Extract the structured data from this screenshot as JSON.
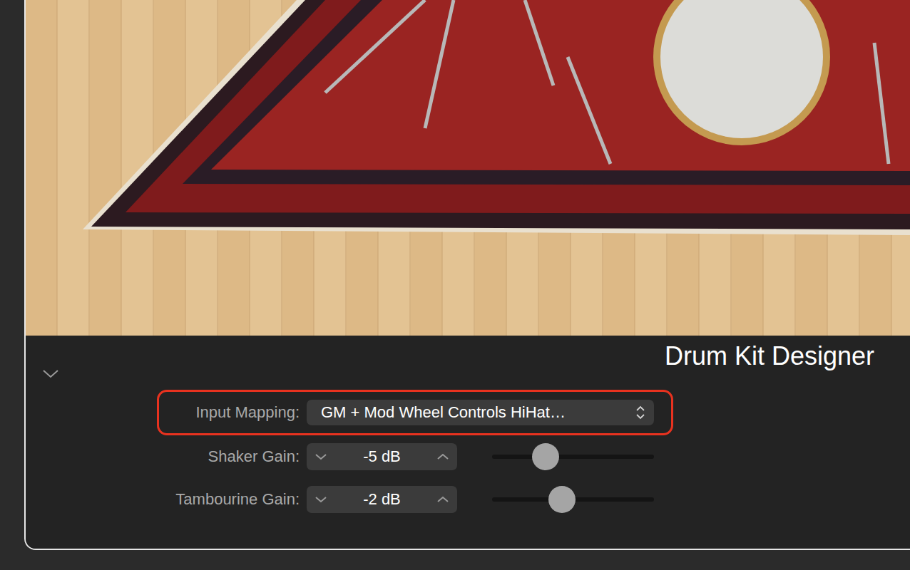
{
  "plugin": {
    "title": "Drum Kit Designer",
    "collapsed": false
  },
  "input_mapping": {
    "label": "Input Mapping:",
    "value": "GM + Mod Wheel Controls HiHat…",
    "highlighted": true
  },
  "gains": [
    {
      "label": "Shaker Gain:",
      "reading": "-5 dB",
      "level": 0.33
    },
    {
      "label": "Tambourine Gain:",
      "reading": "-2 dB",
      "level": 0.43
    }
  ]
}
